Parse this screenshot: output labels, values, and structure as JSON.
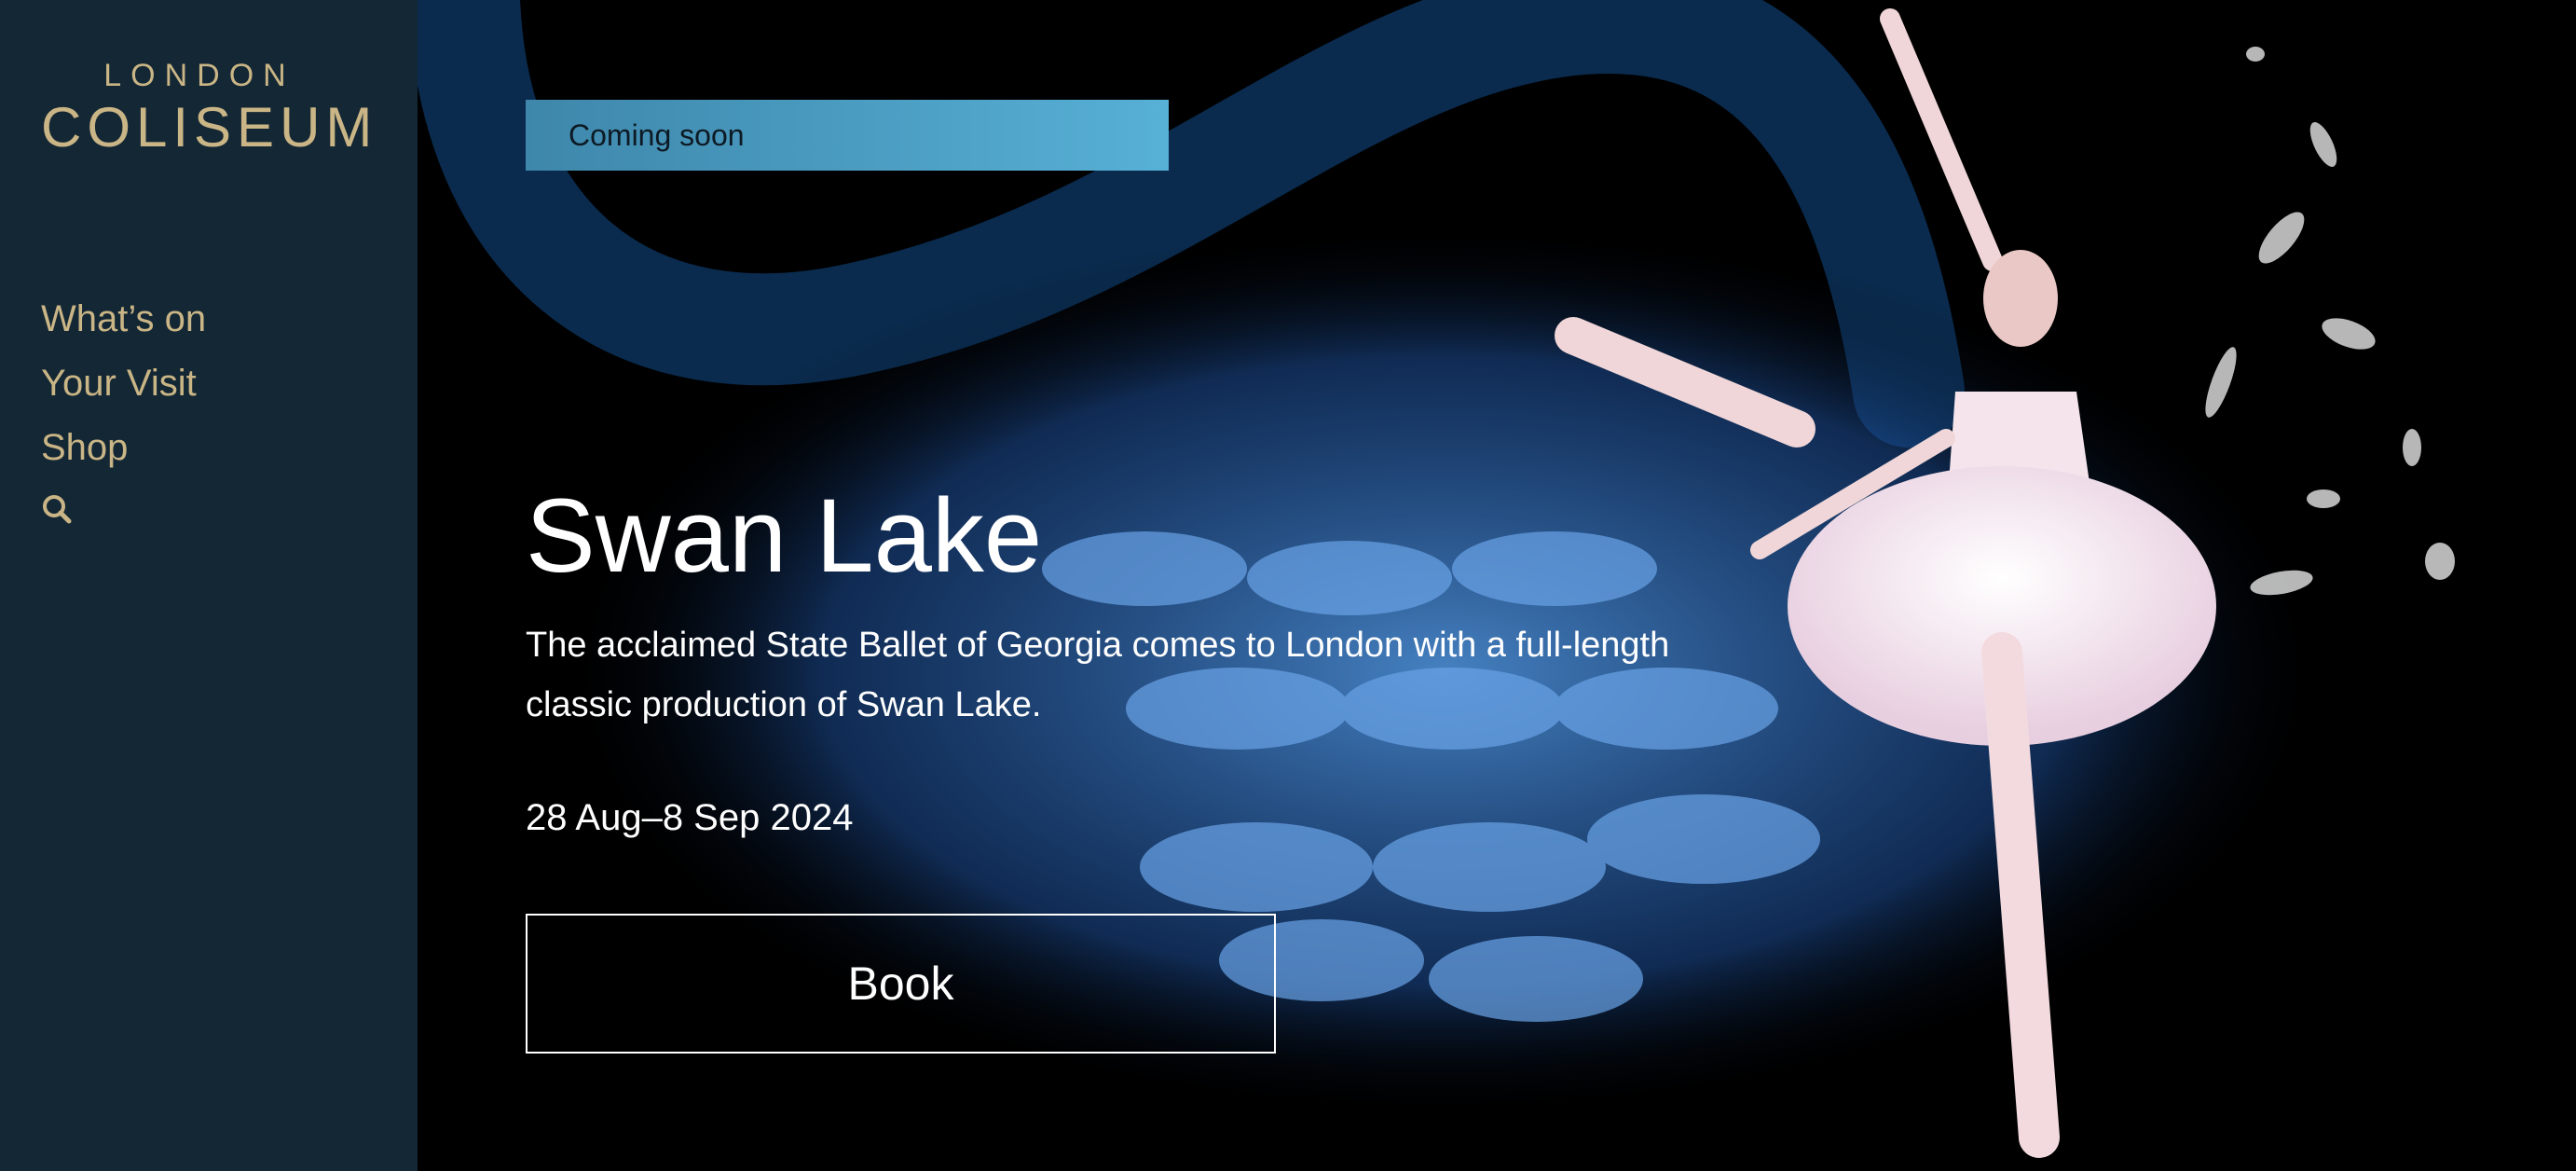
{
  "logo": {
    "line1": "LONDON",
    "line2": "COLISEUM"
  },
  "nav": {
    "items": [
      {
        "label": "What’s on"
      },
      {
        "label": "Your Visit"
      },
      {
        "label": "Shop"
      }
    ],
    "search_icon": "search-icon"
  },
  "hero": {
    "badge": "Coming soon",
    "title": "Swan Lake",
    "description": "The acclaimed State Ballet of Georgia comes to London with a full-length classic production of Swan Lake.",
    "dates": "28 Aug–8 Sep 2024",
    "book_label": "Book"
  },
  "colors": {
    "sidebar_bg": "#142735",
    "accent_gold": "#c9b585",
    "badge_blue": "#57b0d6",
    "hero_bg": "#000000"
  }
}
